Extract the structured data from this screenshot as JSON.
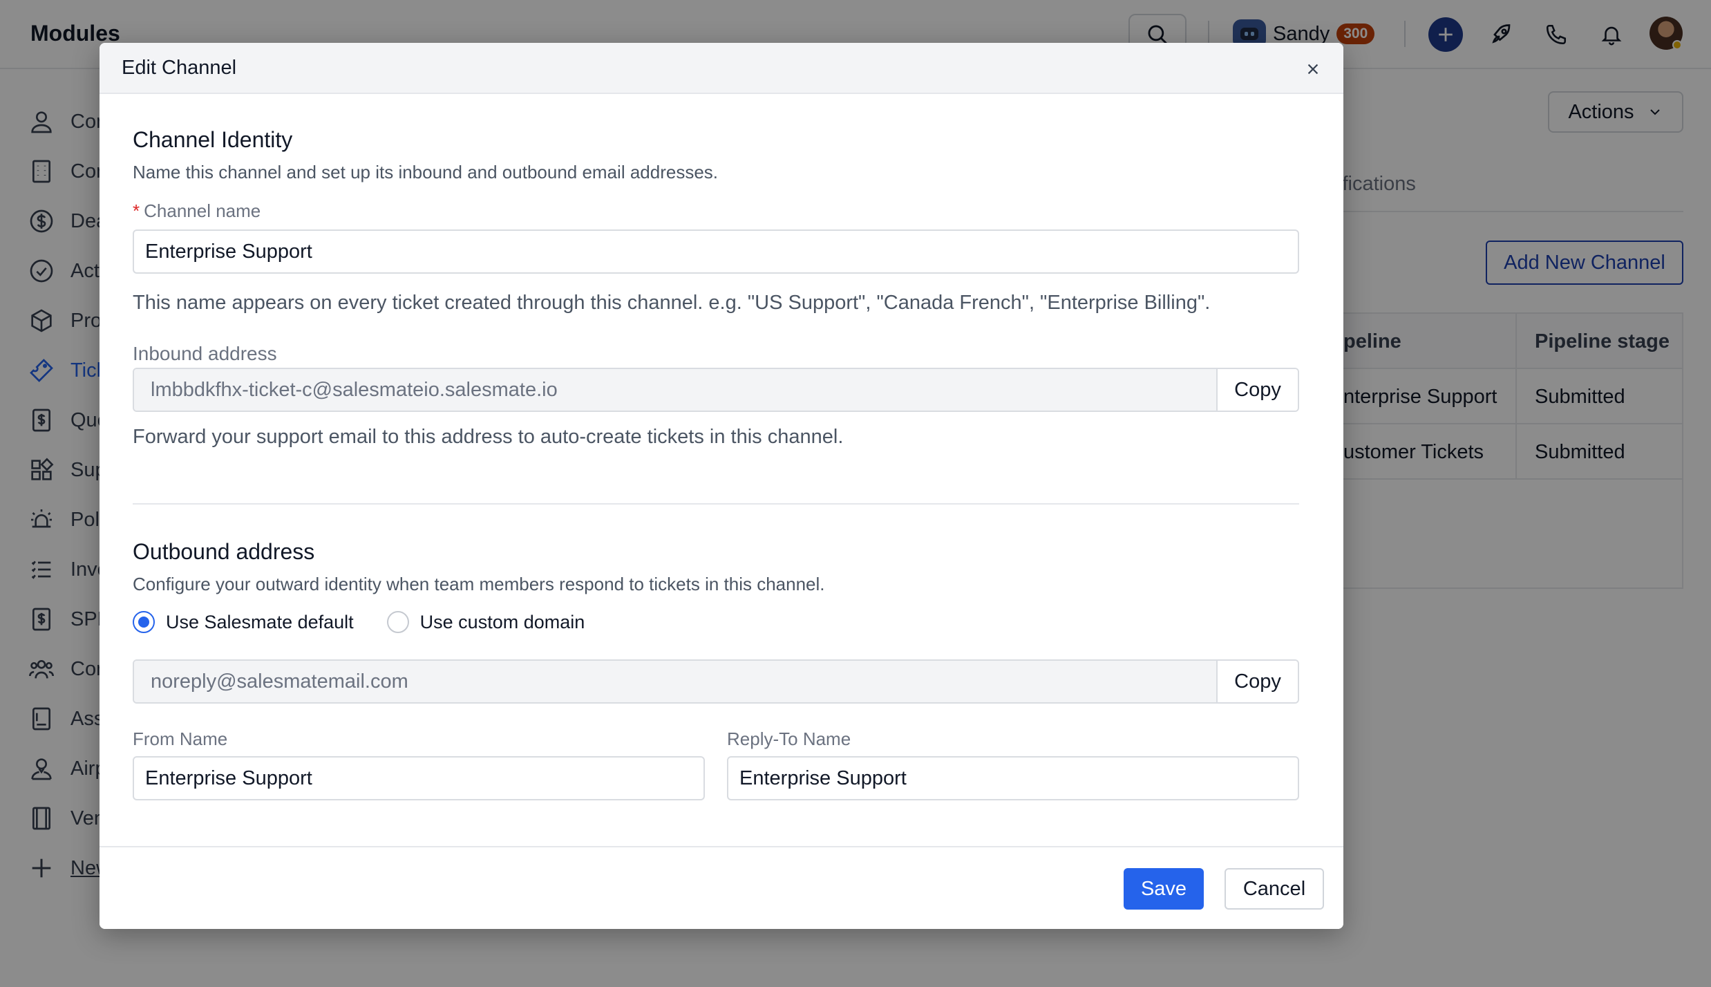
{
  "app": {
    "title": "Modules",
    "user": {
      "name": "Sandy",
      "badge": "300"
    },
    "sidebar": [
      {
        "label": "Con",
        "icon": "user-icon"
      },
      {
        "label": "Con",
        "icon": "building-icon"
      },
      {
        "label": "Dea",
        "icon": "dollar-circle-icon"
      },
      {
        "label": "Act",
        "icon": "check-circle-icon"
      },
      {
        "label": "Pro",
        "icon": "cube-icon"
      },
      {
        "label": "Tick",
        "icon": "ticket-icon"
      },
      {
        "label": "Quo",
        "icon": "quote-icon"
      },
      {
        "label": "Sup",
        "icon": "apps-icon"
      },
      {
        "label": "Poli",
        "icon": "alarm-icon"
      },
      {
        "label": "Invo",
        "icon": "list-icon"
      },
      {
        "label": "SPF",
        "icon": "dollar-doc-icon"
      },
      {
        "label": "Con",
        "icon": "users-icon"
      },
      {
        "label": "Ass",
        "icon": "asset-icon"
      },
      {
        "label": "Airp",
        "icon": "person-pin-icon"
      },
      {
        "label": "Ven",
        "icon": "book-icon"
      },
      {
        "label": "New",
        "icon": "plus-icon"
      }
    ],
    "actions_label": "Actions",
    "tab_partial": "ifications",
    "add_channel_label": "Add New Channel",
    "table": {
      "headers": [
        "peline",
        "Pipeline stage"
      ],
      "rows": [
        [
          "nterprise Support",
          "Submitted"
        ],
        [
          "ustomer Tickets",
          "Submitted"
        ]
      ]
    }
  },
  "modal": {
    "title": "Edit Channel",
    "identity": {
      "title": "Channel Identity",
      "description": "Name this channel and set up its inbound and outbound email addresses.",
      "required_mark": "*",
      "channel_name_label": "Channel name",
      "channel_name_value": "Enterprise Support",
      "channel_name_help": "This name appears on every ticket created through this channel. e.g. \"US Support\", \"Canada French\", \"Enterprise Billing\".",
      "inbound_label": "Inbound address",
      "inbound_value": "lmbbdkfhx-ticket-c@salesmateio.salesmate.io",
      "copy_label": "Copy",
      "inbound_help": "Forward your support email to this address to auto-create tickets in this channel."
    },
    "outbound": {
      "title": "Outbound address",
      "description": "Configure your outward identity when team members respond to tickets in this channel.",
      "option_default": "Use Salesmate default",
      "option_custom": "Use custom domain",
      "selected": "default",
      "address_value": "noreply@salesmatemail.com",
      "copy_label": "Copy",
      "from_name_label": "From Name",
      "from_name_value": "Enterprise Support",
      "reply_to_label": "Reply-To Name",
      "reply_to_value": "Enterprise Support"
    },
    "footer": {
      "save_label": "Save",
      "cancel_label": "Cancel"
    }
  },
  "colors": {
    "primary": "#2563eb",
    "dark_blue": "#1e3a8a",
    "badge": "#c2410c",
    "required": "#dc2626"
  }
}
